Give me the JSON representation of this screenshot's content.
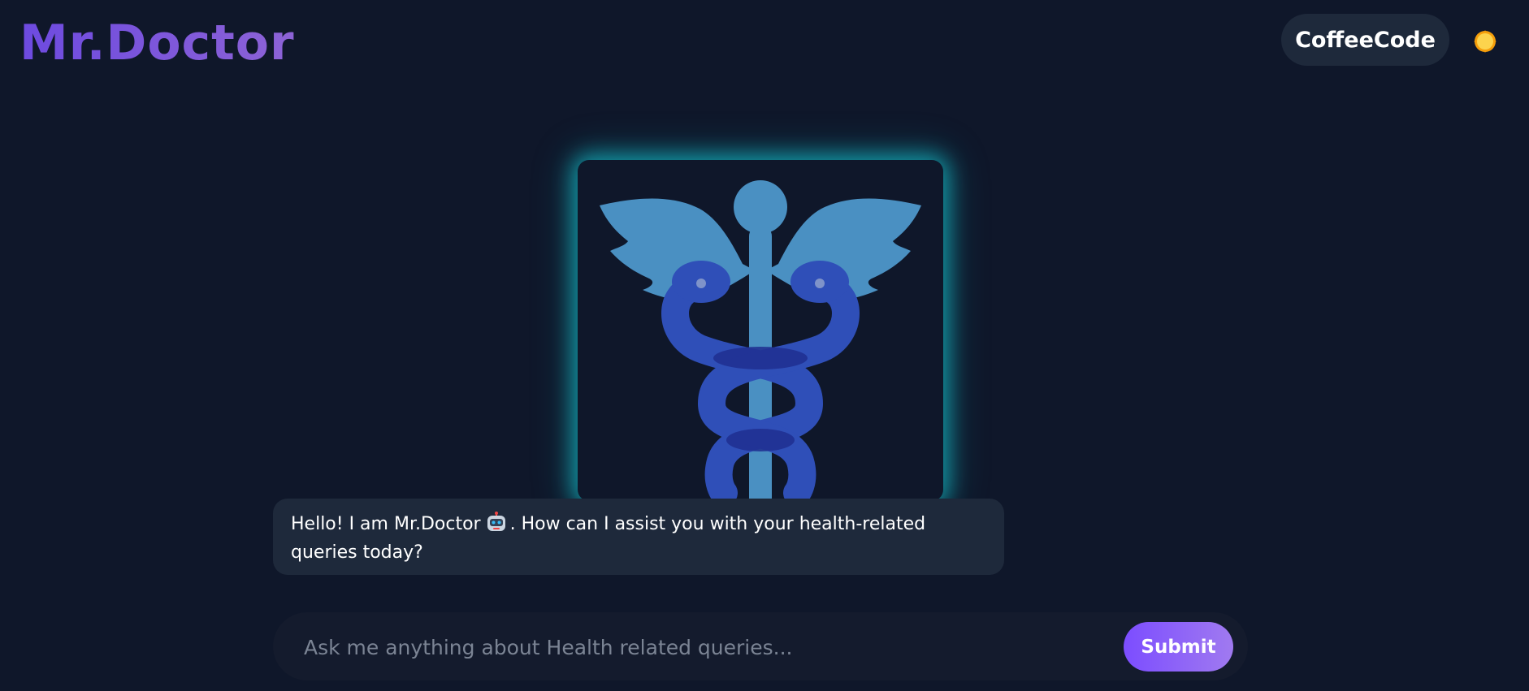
{
  "header": {
    "brand": "Mr.Doctor",
    "user_name": "CoffeeCode",
    "theme_icon": "sun-icon"
  },
  "hero": {
    "icon": "caduceus-icon",
    "colors": {
      "wings_and_staff": "#4a90c2",
      "snakes": "#2f4fb8",
      "glow": "#14b8c4"
    }
  },
  "chat": {
    "messages": [
      {
        "role": "assistant",
        "text_before": "Hello! I am Mr.Doctor",
        "emoji": "robot-icon",
        "text_after": ". How can I assist you with your health-related queries today?"
      }
    ]
  },
  "composer": {
    "placeholder": "Ask me anything about Health related queries...",
    "value": "",
    "submit_label": "Submit"
  },
  "colors": {
    "background": "#0f172a",
    "surface": "#1e293b",
    "accent": "#7c4dff"
  }
}
